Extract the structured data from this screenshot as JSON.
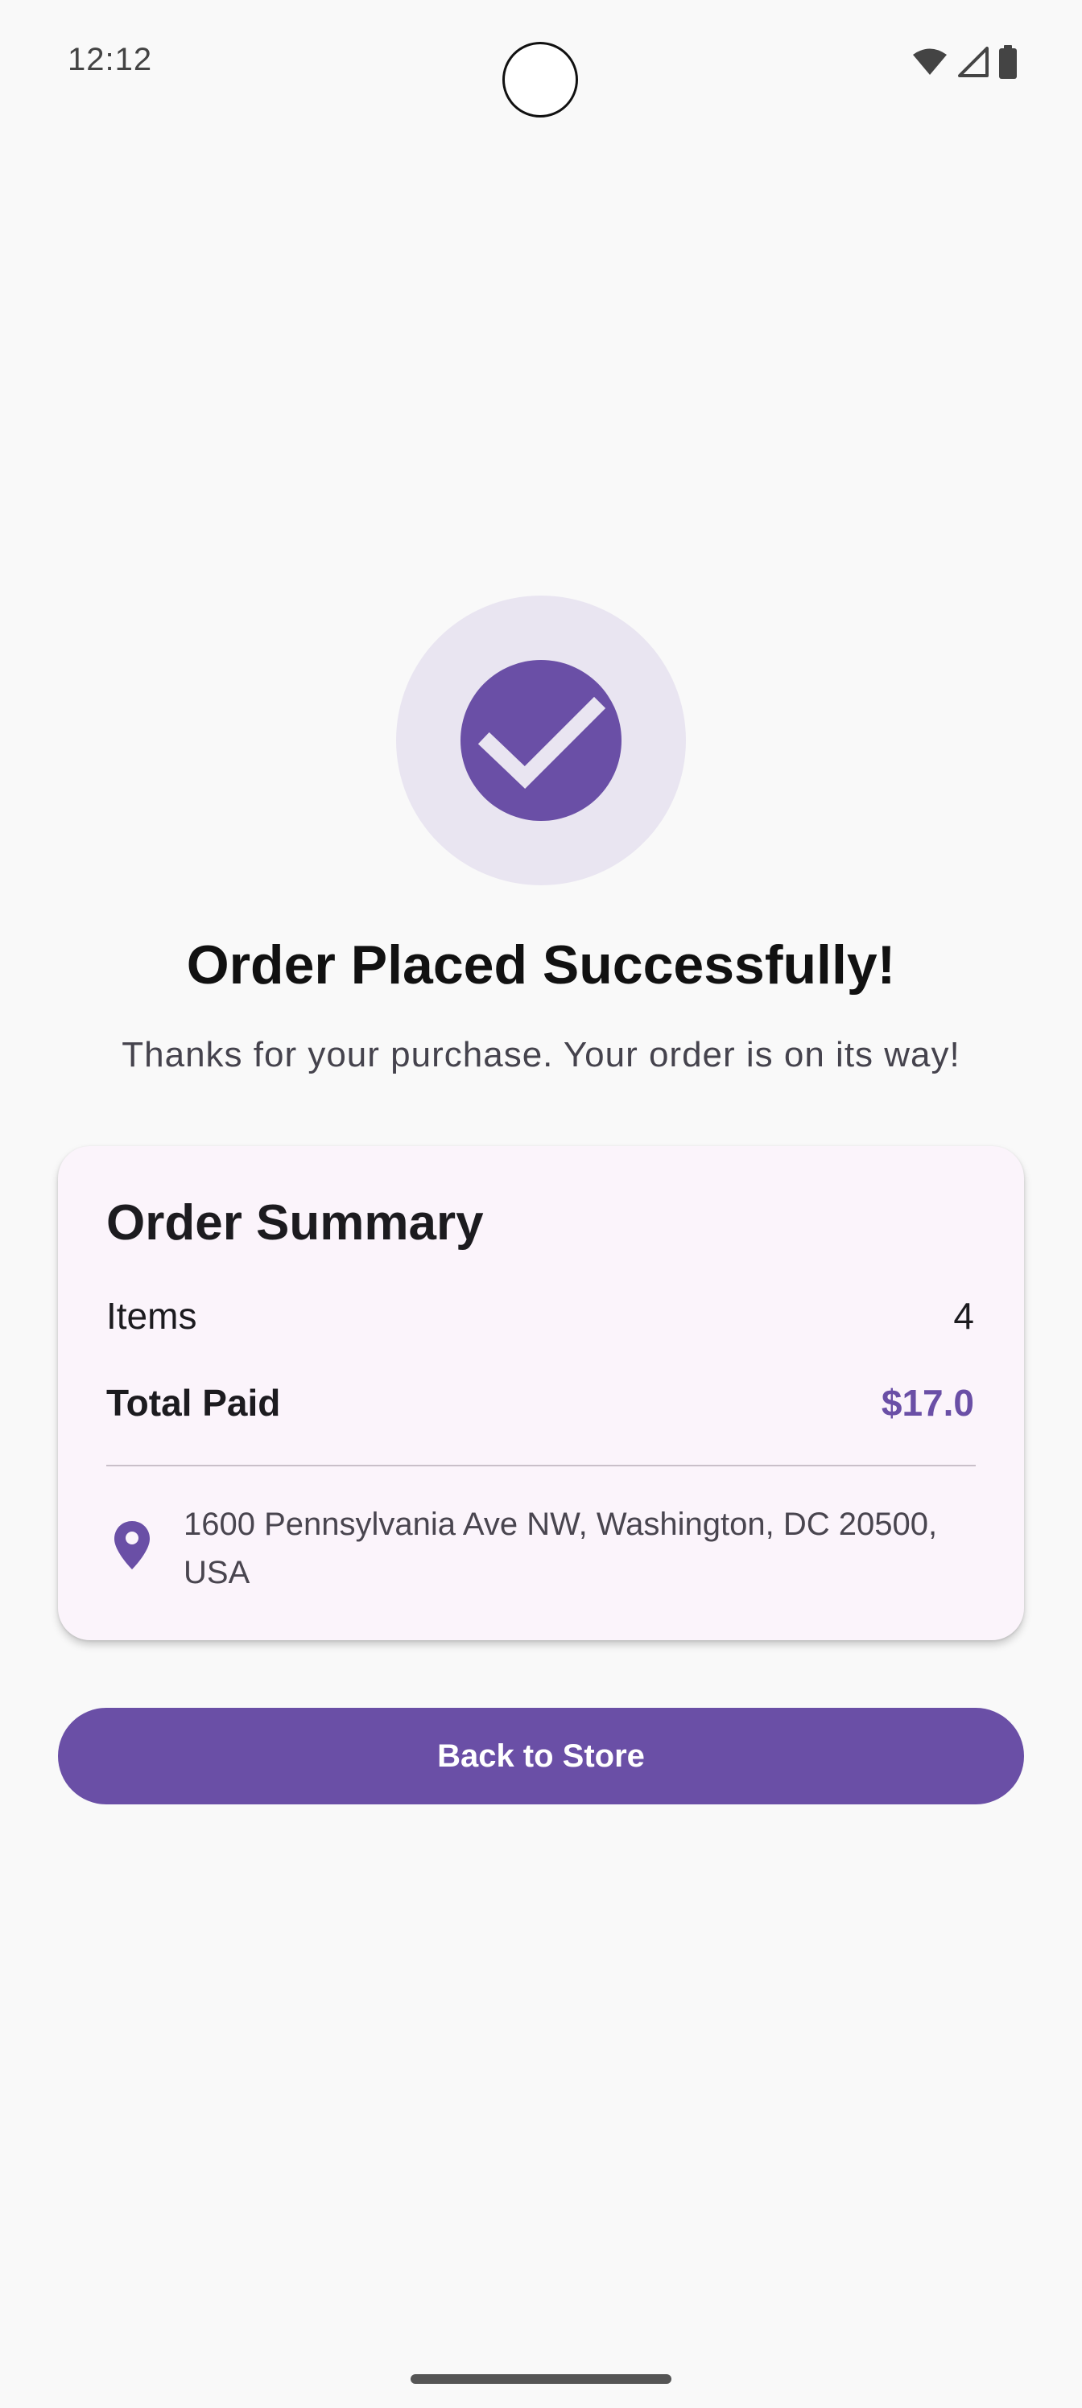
{
  "status_bar": {
    "time": "12:12",
    "icons": [
      "wifi-icon",
      "cell-signal-icon",
      "battery-icon"
    ]
  },
  "success": {
    "icon": "check-icon",
    "title": "Order Placed Successfully!",
    "subtitle": "Thanks for your purchase. Your order is on its way!"
  },
  "summary": {
    "title": "Order Summary",
    "items_label": "Items",
    "items_value": "4",
    "total_label": "Total Paid",
    "total_value": "$17.0",
    "address_icon": "location-pin-icon",
    "address": "1600 Pennsylvania Ave NW, Washington, DC 20500, USA"
  },
  "actions": {
    "back_label": "Back to Store"
  },
  "colors": {
    "accent": "#6a4fa6",
    "badge_bg": "#e9e5f1",
    "card_bg": "#fbf4fb",
    "screen_bg": "#f9f9f9"
  }
}
